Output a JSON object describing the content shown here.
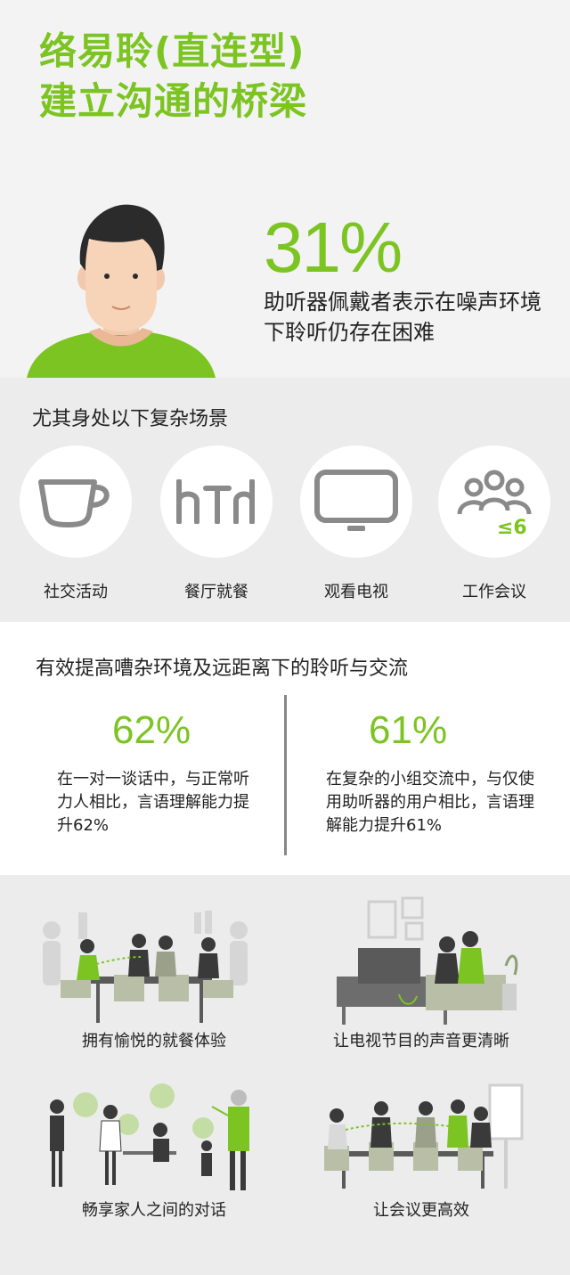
{
  "header": {
    "title_line1": "络易聆(直连型)",
    "title_line2": "建立沟通的桥梁"
  },
  "hero": {
    "percent": "31%",
    "description": "助听器佩戴者表示在噪声环境下聆听仍存在困难"
  },
  "scenes": {
    "title": "尤其身处以下复杂场景",
    "items": [
      {
        "label": "社交活动",
        "icon": "coffee-cup-icon"
      },
      {
        "label": "餐厅就餐",
        "icon": "restaurant-icon",
        "glyph": "hTd"
      },
      {
        "label": "观看电视",
        "icon": "tv-icon"
      },
      {
        "label": "工作会议",
        "icon": "meeting-group-icon",
        "badge": "≤6"
      }
    ]
  },
  "stats": {
    "title": "有效提高嘈杂环境及远距离下的聆听与交流",
    "items": [
      {
        "percent": "62%",
        "description": "在一对一谈话中，与正常听力人相比，言语理解能力提升62%"
      },
      {
        "percent": "61%",
        "description": "在复杂的小组交流中，与仅使用助听器的用户相比，言语理解能力提升61%"
      }
    ]
  },
  "benefits": {
    "items": [
      {
        "label": "拥有愉悦的就餐体验"
      },
      {
        "label": "让电视节目的声音更清晰"
      },
      {
        "label": "畅享家人之间的对话"
      },
      {
        "label": "让会议更高效"
      }
    ]
  },
  "colors": {
    "accent": "#7cc422",
    "icon_gray": "#8a8a8a",
    "background_light": "#f3f3f3",
    "background_gray": "#ececec"
  }
}
